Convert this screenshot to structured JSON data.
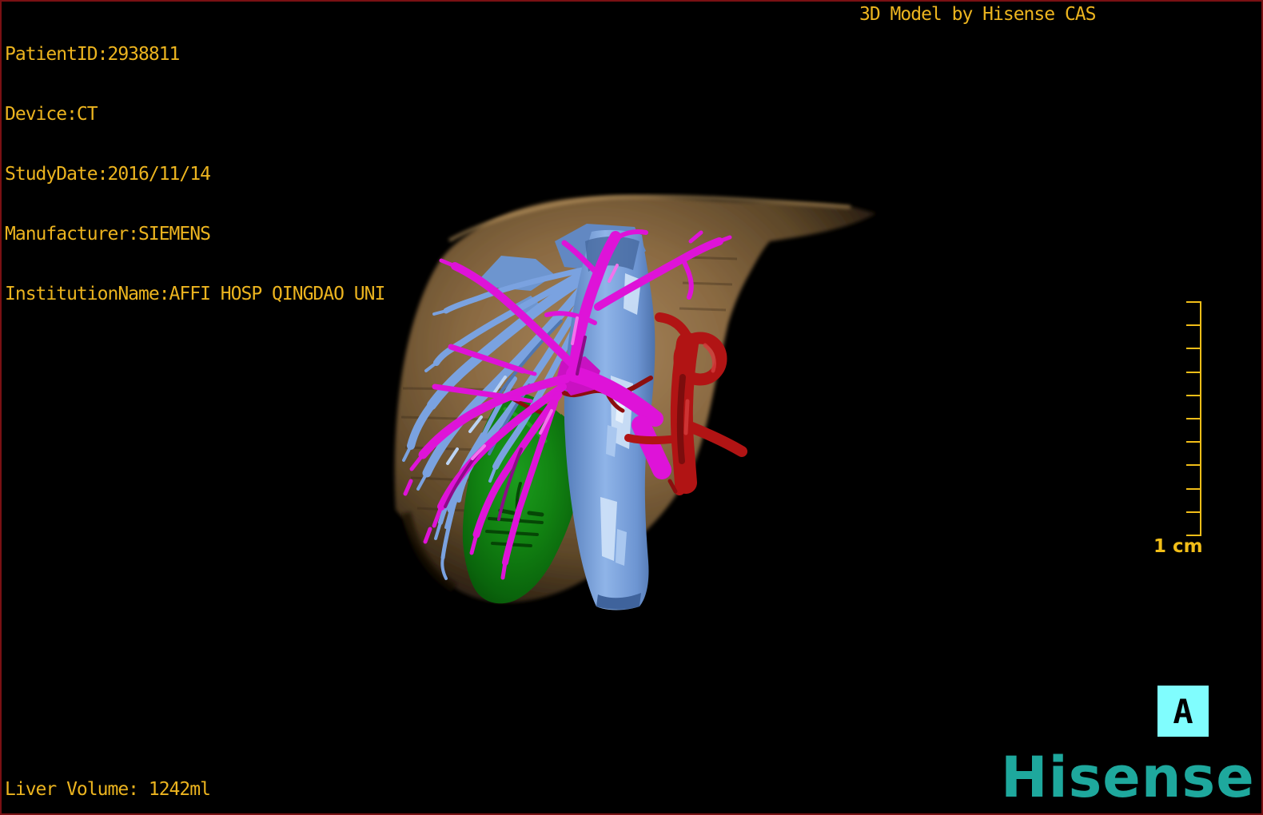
{
  "viewer": {
    "title": "3D Model by Hisense CAS",
    "patient_lines": [
      "PatientID:2938811",
      "Device:CT",
      "StudyDate:2016/11/14",
      "Manufacturer:SIEMENS",
      "InstitutionName:AFFI HOSP QINGDAO UNI"
    ],
    "liver_volume": "Liver Volume: 1242ml"
  },
  "scale_bar": {
    "label": "1 cm",
    "tick_count": 11
  },
  "orientation_marker": {
    "label": "A"
  },
  "branding": {
    "logo": "Hisense"
  },
  "model": {
    "structures": [
      {
        "name": "liver-surface",
        "color": "#9c7a4e"
      },
      {
        "name": "hepatic-vein-tree",
        "color": "#7aa2e0"
      },
      {
        "name": "inferior-vena-cava",
        "color": "#7aa2e0"
      },
      {
        "name": "portal-vein-tree",
        "color": "#de13d8"
      },
      {
        "name": "hepatic-artery",
        "color": "#b11414"
      },
      {
        "name": "lesion",
        "color": "#128412"
      }
    ]
  },
  "colors": {
    "background": "#000000",
    "frame_border": "#7a1013",
    "overlay_text": "#ecb41f",
    "scale_bar": "#f2be18",
    "marker_background": "#80fdfe",
    "marker_text": "#000000",
    "logo": "#1ea89d",
    "liver": "#9c7a4e",
    "hepatic_vein": "#7aa2e0",
    "portal_vein": "#de13d8",
    "artery": "#b11414",
    "lesion": "#128412"
  }
}
